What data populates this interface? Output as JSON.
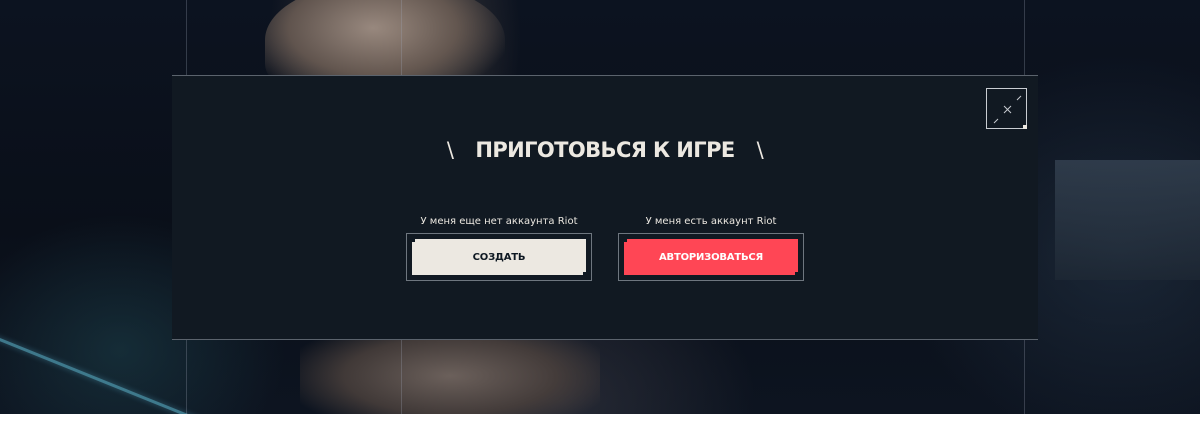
{
  "modal": {
    "title": "ПРИГОТОВЬСЯ К ИГРЕ",
    "title_prefix": "\\",
    "title_suffix": "\\",
    "close_icon": "collapse-arrows-icon"
  },
  "options": [
    {
      "caption": "У меня еще нет аккаунта Riot",
      "button_label": "СОЗДАТЬ",
      "button_color": "#ece8e1"
    },
    {
      "caption": "У меня есть аккаунт Riot",
      "button_label": "АВТОРИЗОВАТЬСЯ",
      "button_color": "#ff4655"
    }
  ],
  "colors": {
    "modal_bg": "#111922",
    "accent_red": "#ff4655",
    "off_white": "#ece8e1"
  }
}
